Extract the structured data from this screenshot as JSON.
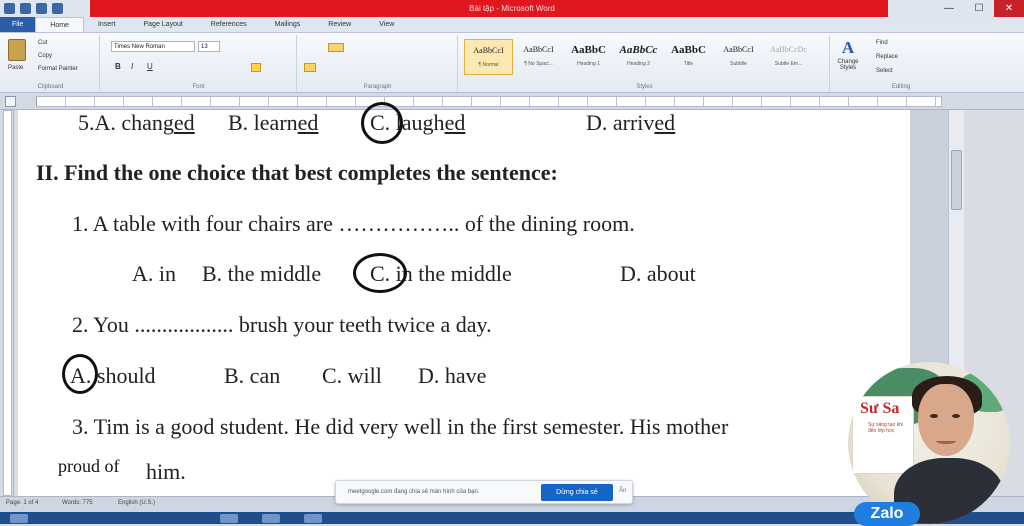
{
  "window": {
    "title": "Bài tập - Microsoft Word",
    "minimize": "—",
    "maximize": "☐",
    "close": "✕"
  },
  "tabs": [
    "File",
    "Home",
    "Insert",
    "Page Layout",
    "References",
    "Mailings",
    "Review",
    "View"
  ],
  "ribbon": {
    "clipboard": {
      "paste": "Paste",
      "cut": "Cut",
      "copy": "Copy",
      "format_painter": "Format Painter",
      "label": "Clipboard"
    },
    "font": {
      "name": "Times New Roman",
      "size": "13",
      "label": "Font",
      "bold": "B",
      "italic": "I",
      "underline": "U"
    },
    "paragraph": {
      "label": "Paragraph"
    },
    "styles": {
      "label": "Styles",
      "items": [
        {
          "sample": "AaBbCcI",
          "name": "¶ Normal"
        },
        {
          "sample": "AaBbCcI",
          "name": "¶ No Spaci..."
        },
        {
          "sample": "AaBbC",
          "name": "Heading 1"
        },
        {
          "sample": "AaBbCc",
          "name": "Heading 2"
        },
        {
          "sample": "AaBbC",
          "name": "Title"
        },
        {
          "sample": "AaBbCcI",
          "name": "Subtitle"
        },
        {
          "sample": "AaBbCcDc",
          "name": "Subtle Em..."
        }
      ],
      "change_styles": "Change Styles"
    },
    "editing": {
      "find": "Find",
      "replace": "Replace",
      "select": "Select",
      "label": "Editing"
    }
  },
  "document": {
    "q5_line": {
      "num": "5.",
      "a": "A. chang",
      "a_ul": "ed",
      "b": "B. learn",
      "b_ul": "ed",
      "c": "C. laugh",
      "c_ul": "ed",
      "d": "D. arriv",
      "d_ul": "ed"
    },
    "section_heading": "II.  Find the one choice that best completes the sentence:",
    "q1": {
      "stem": "1.  A table with four chairs are …………….. of the dining room.",
      "a": "A. in",
      "b": "B. the middle",
      "c": "C. in the middle",
      "d": "D. about"
    },
    "q2": {
      "stem": "2.  You .................. brush your teeth twice a day.",
      "a": "A. should",
      "b": "B. can",
      "c": "C. will",
      "d": "D. have"
    },
    "q3": {
      "stem": "3.  Tim is a good student. He did very well in the first semester. His mother",
      "cont": "him."
    },
    "overlay_text": "proud of"
  },
  "statusbar": {
    "page": "Page: 1 of 4",
    "words": "Words: 775",
    "language": "English (U.S.)"
  },
  "notification": {
    "text": "meetgoogle.com đang chia sẻ màn hình của bạn.",
    "stop_button": "Dừng chia sẻ",
    "hide": "Ẩn"
  },
  "webcam": {
    "sign_title": "Sư Sa",
    "sign_subtitle": "Sự sáng tạo khi đến lớp học",
    "badge": "Zalo"
  }
}
